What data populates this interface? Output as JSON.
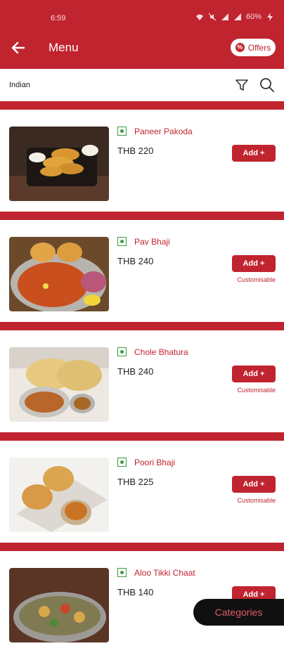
{
  "status_bar": {
    "time": "6:59",
    "battery": "60%"
  },
  "header": {
    "title": "Menu",
    "offers_label": "Offers",
    "offers_icon": "offers-percent-icon"
  },
  "search": {
    "text": "Indian"
  },
  "colors": {
    "primary": "#c0242f",
    "veg": "#3e9b3e",
    "dark": "#101010"
  },
  "items": [
    {
      "name": "Paneer Pakoda",
      "price": "THB 220",
      "add_label": "Add +",
      "customisable": ""
    },
    {
      "name": "Pav Bhaji",
      "price": "THB 240",
      "add_label": "Add +",
      "customisable": "Customisable"
    },
    {
      "name": "Chole Bhatura",
      "price": "THB 240",
      "add_label": "Add +",
      "customisable": "Customisable"
    },
    {
      "name": "Poori Bhaji",
      "price": "THB 225",
      "add_label": "Add +",
      "customisable": "Customisable"
    },
    {
      "name": "Aloo Tikki Chaat",
      "price": "THB 140",
      "add_label": "Add +",
      "customisable": ""
    }
  ],
  "categories_label": "Categories"
}
